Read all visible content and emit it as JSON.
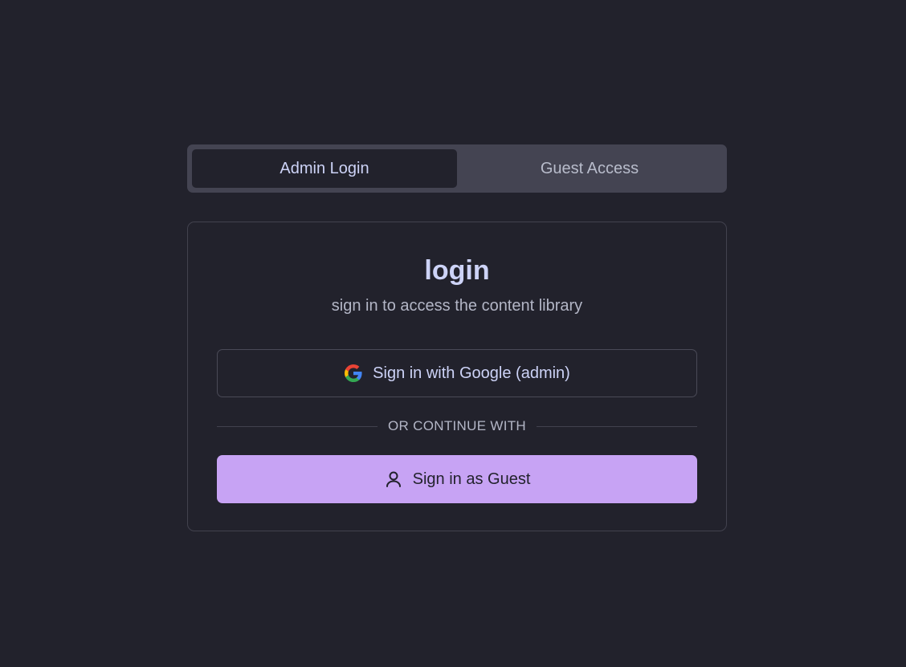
{
  "tabs": [
    {
      "label": "Admin Login",
      "active": true
    },
    {
      "label": "Guest Access",
      "active": false
    }
  ],
  "card": {
    "title": "login",
    "subtitle": "sign in to access the content library",
    "google_button_label": "Sign in with Google (admin)",
    "google_icon": "google-g-logo-icon",
    "divider_label": "OR CONTINUE WITH",
    "guest_button_label": "Sign in as Guest",
    "guest_icon": "user-icon"
  },
  "colors": {
    "background": "#22222c",
    "accent": "#c7a3f4",
    "text_primary": "#cdd3f7",
    "text_muted": "#b3b6c6"
  }
}
